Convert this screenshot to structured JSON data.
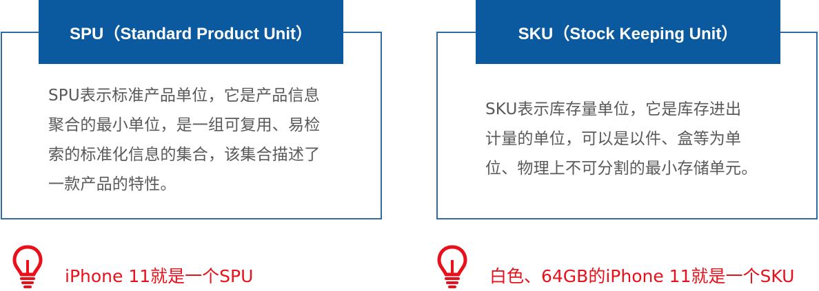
{
  "spu": {
    "title": "SPU（Standard Product Unit）",
    "description_lines": [
      "SPU表示标准产品单位，它是产品信息",
      "聚合的最小单位，是一组可复用、易检",
      "索的标准化信息的集合，该集合描述了",
      "一款产品的特性。"
    ],
    "example": "iPhone 11就是一个SPU",
    "icon": "lightbulb-icon"
  },
  "sku": {
    "title": "SKU（Stock Keeping Unit）",
    "description_lines": [
      "SKU表示库存量单位，它是库存进出",
      "计量的单位，可以是以件、盒等为单",
      "位、物理上不可分割的最小存储单元。"
    ],
    "example": "白色、64GB的iPhone 11就是一个SKU",
    "icon": "lightbulb-icon"
  },
  "colors": {
    "header_bg": "#0b5aa0",
    "border": "#2f6aa6",
    "body_text": "#595959",
    "accent_red": "#e8101a"
  }
}
